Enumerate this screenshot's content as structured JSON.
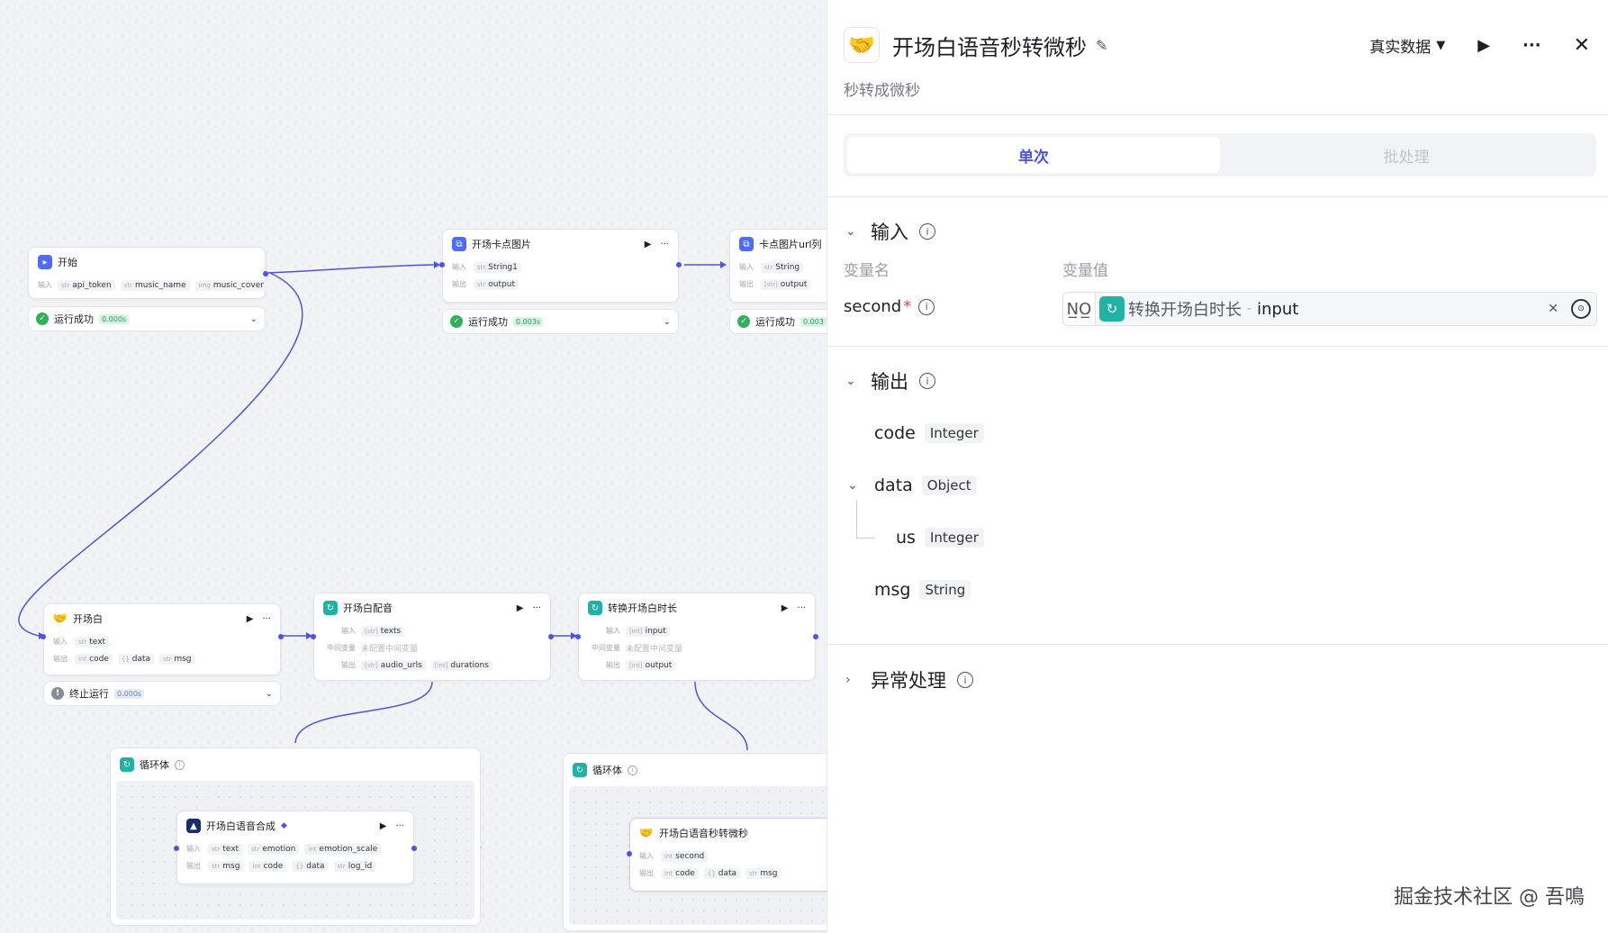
{
  "nodes": {
    "start": {
      "title": "开始",
      "in_label": "输入",
      "params": [
        "api_token",
        "music_name",
        "music_cover"
      ],
      "types": [
        "str",
        "str",
        "img"
      ]
    },
    "start_status": {
      "text": "运行成功",
      "time": "0.000s"
    },
    "card_img": {
      "title": "开场卡点图片",
      "in_label": "输入",
      "out_label": "输出",
      "in_param": "String1",
      "in_type": "str",
      "out_param": "output",
      "out_type": "str"
    },
    "card_img_status": {
      "text": "运行成功",
      "time": "0.003s"
    },
    "card_url": {
      "title": "卡点图片url列",
      "in_label": "输入",
      "out_label": "输出",
      "in_param": "String",
      "in_type": "str",
      "out_param": "output",
      "out_type": "[str]"
    },
    "card_url_status": {
      "text": "运行成功",
      "time": "0.003"
    },
    "opening": {
      "title": "开场白",
      "in_label": "输入",
      "out_label": "输出",
      "in_param": "text",
      "in_type": "str",
      "outs": [
        "code",
        "data",
        "msg"
      ],
      "out_types": [
        "int",
        "{}",
        "str"
      ]
    },
    "opening_status": {
      "text": "终止运行",
      "time": "0.000s"
    },
    "dubbing": {
      "title": "开场白配音",
      "in_label": "输入",
      "mid_label": "中间变量",
      "out_label": "输出",
      "in_param": "texts",
      "in_type": "[str]",
      "mid_text": "未配置中间变量",
      "outs": [
        "audio_urls",
        "durations"
      ],
      "out_types": [
        "[str]",
        "[int]"
      ]
    },
    "convert": {
      "title": "转换开场白时长",
      "in_label": "输入",
      "mid_label": "中间变量",
      "out_label": "输出",
      "in_param": "input",
      "in_type": "[int]",
      "mid_text": "未配置中间变量",
      "out_param": "output",
      "out_type": "[int]"
    },
    "loop1": {
      "title": "循环体"
    },
    "tts": {
      "title": "开场白语音合成",
      "in_label": "输入",
      "out_label": "输出",
      "ins": [
        "text",
        "emotion",
        "emotion_scale"
      ],
      "in_types": [
        "str",
        "str",
        "int"
      ],
      "outs": [
        "msg",
        "code",
        "data",
        "log_id"
      ],
      "out_types": [
        "str",
        "int",
        "{}",
        "str"
      ]
    },
    "loop2": {
      "title": "循环体"
    },
    "sec2us": {
      "title": "开场白语音秒转微秒",
      "in_label": "输入",
      "out_label": "输出",
      "in_param": "second",
      "in_type": "int",
      "outs": [
        "code",
        "data",
        "msg"
      ],
      "out_types": [
        "int",
        "{}",
        "str"
      ]
    }
  },
  "panel": {
    "title": "开场白语音秒转微秒",
    "subtitle": "秒转成微秒",
    "mode": "真实数据",
    "tabs": [
      "单次",
      "批处理"
    ],
    "input_section": "输入",
    "col_name": "变量名",
    "col_value": "变量值",
    "var_name": "second",
    "var_required": "*",
    "var_type_badge": "N̲O̲",
    "ref_node": "转换开场白时长",
    "ref_sep": "-",
    "ref_field": "input",
    "output_section": "输出",
    "outputs": [
      {
        "name": "code",
        "type": "Integer"
      },
      {
        "name": "data",
        "type": "Object"
      },
      {
        "name": "us",
        "type": "Integer"
      },
      {
        "name": "msg",
        "type": "String"
      }
    ],
    "error_section": "异常处理"
  },
  "watermark": "掘金技术社区 @ 吾鳴",
  "colors": {
    "accent": "#4d53e8",
    "success": "#2fb15a",
    "teal": "#1fb3a8"
  }
}
